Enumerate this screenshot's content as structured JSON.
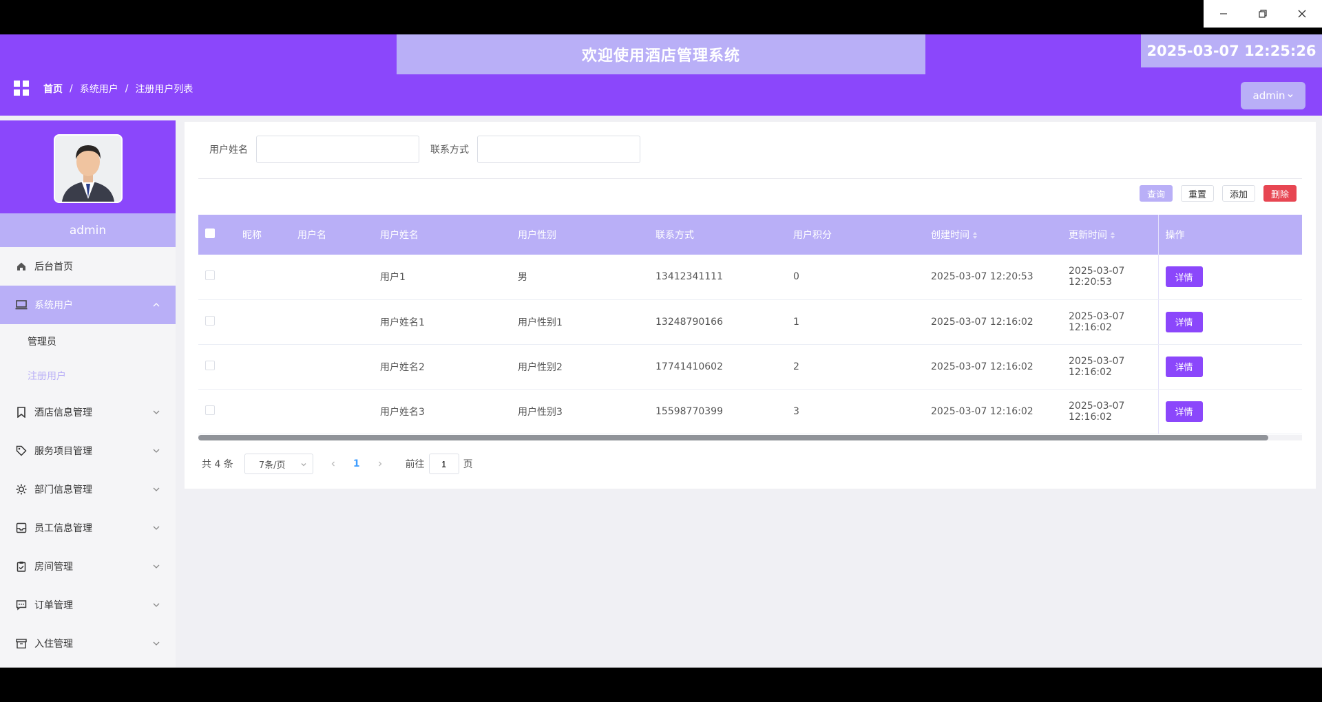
{
  "header": {
    "title": "欢迎使用酒店管理系统",
    "datetime": "2025-03-07 12:25:26",
    "breadcrumb": [
      "首页",
      "系统用户",
      "注册用户列表"
    ],
    "user": "admin"
  },
  "sidebar": {
    "username": "admin",
    "items": [
      {
        "label": "后台首页",
        "icon": "home-icon"
      },
      {
        "label": "系统用户",
        "icon": "monitor-icon",
        "active": true,
        "expanded": true,
        "children": [
          {
            "label": "管理员"
          },
          {
            "label": "注册用户",
            "current": true
          }
        ]
      },
      {
        "label": "酒店信息管理",
        "icon": "bookmark-icon"
      },
      {
        "label": "服务项目管理",
        "icon": "tag-icon"
      },
      {
        "label": "部门信息管理",
        "icon": "sun-icon"
      },
      {
        "label": "员工信息管理",
        "icon": "inbox-icon"
      },
      {
        "label": "房间管理",
        "icon": "clipboard-icon"
      },
      {
        "label": "订单管理",
        "icon": "chat-icon"
      },
      {
        "label": "入住管理",
        "icon": "archive-icon"
      }
    ]
  },
  "search": {
    "name_label": "用户姓名",
    "name_value": "",
    "phone_label": "联系方式",
    "phone_value": ""
  },
  "actions": {
    "query": "查询",
    "reset": "重置",
    "add": "添加",
    "delete": "删除"
  },
  "table": {
    "columns": [
      "昵称",
      "用户名",
      "用户姓名",
      "用户性别",
      "联系方式",
      "用户积分",
      "创建时间",
      "更新时间",
      "操作"
    ],
    "rows": [
      {
        "nickname": "",
        "username": "",
        "name": "用户1",
        "gender": "男",
        "phone": "13412341111",
        "points": "0",
        "created": "2025-03-07 12:20:53",
        "updated": "2025-03-07 12:20:53"
      },
      {
        "nickname": "",
        "username": "",
        "name": "用户姓名1",
        "gender": "用户性别1",
        "phone": "13248790166",
        "points": "1",
        "created": "2025-03-07 12:16:02",
        "updated": "2025-03-07 12:16:02"
      },
      {
        "nickname": "",
        "username": "",
        "name": "用户姓名2",
        "gender": "用户性别2",
        "phone": "17741410602",
        "points": "2",
        "created": "2025-03-07 12:16:02",
        "updated": "2025-03-07 12:16:02"
      },
      {
        "nickname": "",
        "username": "",
        "name": "用户姓名3",
        "gender": "用户性别3",
        "phone": "15598770399",
        "points": "3",
        "created": "2025-03-07 12:16:02",
        "updated": "2025-03-07 12:16:02"
      }
    ],
    "detail_label": "详情"
  },
  "pagination": {
    "total": "共 4 条",
    "page_size": "7条/页",
    "current": "1",
    "goto_label": "前往",
    "goto_value": "1",
    "page_suffix": "页"
  },
  "colors": {
    "primary": "#8b47fb",
    "light": "#b9aff7",
    "danger": "#e74652"
  }
}
